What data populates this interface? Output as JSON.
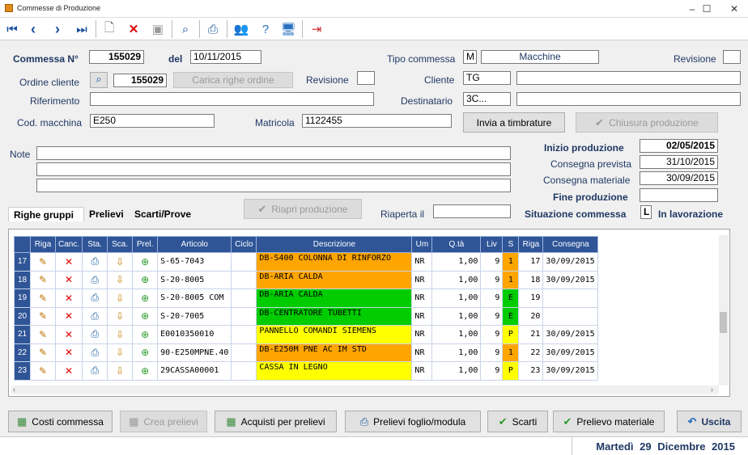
{
  "window": {
    "title": "Commesse di Produzione",
    "minimize": "–",
    "maximize": "☐",
    "close": "✕"
  },
  "form": {
    "commessa_label": "Commessa N°",
    "commessa_value": "155029",
    "del_label": "del",
    "del_value": "10/11/2015",
    "tipo_commessa_label": "Tipo commessa",
    "tipo_code": "M",
    "tipo_desc": "Macchine",
    "revisione_label": "Revisione",
    "revisione_value": "",
    "ordine_cliente_label": "Ordine cliente",
    "ordine_cliente_value": "155029",
    "carica_righe_label": "Carica righe ordine",
    "revisione2_label": "Revisione",
    "revisione2_value": "",
    "cliente_label": "Cliente",
    "cliente_code": "TG",
    "cliente_desc": "",
    "riferimento_label": "Riferimento",
    "riferimento_value": "",
    "destinatario_label": "Destinatario",
    "destinatario_code": "3C...",
    "destinatario_desc": "",
    "cod_macchina_label": "Cod. macchina",
    "cod_macchina_value": "E250",
    "matricola_label": "Matricola",
    "matricola_value": "1122455",
    "invia_timbrature_label": "Invia a timbrature",
    "chiusura_produzione_label": "Chiusura produzione",
    "note_label": "Note",
    "note_lines": [
      "",
      "",
      ""
    ],
    "inizio_produzione_label": "Inizio produzione",
    "inizio_produzione_value": "02/05/2015",
    "consegna_prevista_label": "Consegna prevista",
    "consegna_prevista_value": "31/10/2015",
    "consegna_materiale_label": "Consegna materiale",
    "consegna_materiale_value": "30/09/2015",
    "fine_produzione_label": "Fine produzione",
    "fine_produzione_value": "",
    "riapri_produzione_label": "Riapri produzione",
    "riaperta_il_label": "Riaperta il",
    "riaperta_il_value": "",
    "situazione_label": "Situazione commessa",
    "situazione_code": "L",
    "situazione_desc": "In lavorazione"
  },
  "tabs": [
    "Righe gruppi",
    "Prelievi",
    "Scarti/Prove"
  ],
  "grid": {
    "columns": [
      "Riga",
      "Canc.",
      "Sta.",
      "Sca.",
      "Prel.",
      "Articolo",
      "Ciclo",
      "Descrizione",
      "Um",
      "Q.tà",
      "Liv",
      "S",
      "Riga",
      "Consegna"
    ],
    "rows": [
      {
        "n": "17",
        "articolo": "S-65-7043",
        "ciclo": "",
        "descrizione": "DB-S400 COLONNA DI RINFORZO",
        "um": "NR",
        "qta": "1,00",
        "liv": "9",
        "s": "1",
        "riga": "17",
        "consegna": "30/09/2015",
        "color": "#ffa500"
      },
      {
        "n": "18",
        "articolo": "S-20-8005",
        "ciclo": "",
        "descrizione": "DB-ARIA CALDA",
        "um": "NR",
        "qta": "1,00",
        "liv": "9",
        "s": "1",
        "riga": "18",
        "consegna": "30/09/2015",
        "color": "#ffa500"
      },
      {
        "n": "19",
        "articolo": "S-20-8005 COM",
        "ciclo": "",
        "descrizione": "DB-ARIA CALDA",
        "um": "NR",
        "qta": "1,00",
        "liv": "9",
        "s": "E",
        "riga": "19",
        "consegna": "",
        "color": "#00cc00"
      },
      {
        "n": "20",
        "articolo": "S-20-7005",
        "ciclo": "",
        "descrizione": "DB-CENTRATORE TUBETTI",
        "um": "NR",
        "qta": "1,00",
        "liv": "9",
        "s": "E",
        "riga": "20",
        "consegna": "",
        "color": "#00cc00"
      },
      {
        "n": "21",
        "articolo": "E0010350010",
        "ciclo": "",
        "descrizione": "PANNELLO COMANDI SIEMENS",
        "um": "NR",
        "qta": "1,00",
        "liv": "9",
        "s": "P",
        "riga": "21",
        "consegna": "30/09/2015",
        "color": "#ffff00"
      },
      {
        "n": "22",
        "articolo": "90-E250MPNE.40",
        "ciclo": "",
        "descrizione": "DB-E250M PNE AC IM STD",
        "um": "NR",
        "qta": "1,00",
        "liv": "9",
        "s": "1",
        "riga": "22",
        "consegna": "30/09/2015",
        "color": "#ffa500"
      },
      {
        "n": "23",
        "articolo": "29CASSA00001",
        "ciclo": "",
        "descrizione": "CASSA IN LEGNO",
        "um": "NR",
        "qta": "1,00",
        "liv": "9",
        "s": "P",
        "riga": "23",
        "consegna": "30/09/2015",
        "color": "#ffff00"
      }
    ]
  },
  "buttons": {
    "costi_commessa": "Costi commessa",
    "crea_prelievi": "Crea prelievi",
    "acquisti_prelievi": "Acquisti per prelievi",
    "prelievi_foglio": "Prelievi foglio/modula",
    "scarti": "Scarti",
    "prelievo_materiale": "Prelievo materiale",
    "uscita": "Uscita"
  },
  "status": {
    "day": "Martedì",
    "date": "29 Dicembre",
    "year": "2015"
  }
}
